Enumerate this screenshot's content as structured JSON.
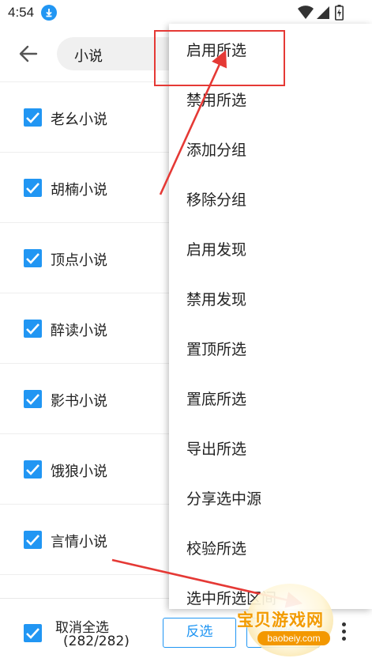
{
  "status_bar": {
    "time": "4:54"
  },
  "toolbar": {
    "search_value": "小说"
  },
  "list": {
    "items": [
      {
        "label": "老幺小说",
        "checked": true
      },
      {
        "label": "胡楠小说",
        "checked": true
      },
      {
        "label": "顶点小说",
        "checked": true
      },
      {
        "label": "醉读小说",
        "checked": true
      },
      {
        "label": "影书小说",
        "checked": true
      },
      {
        "label": "饿狼小说",
        "checked": true
      },
      {
        "label": "言情小说",
        "checked": true
      }
    ]
  },
  "menu": {
    "items": [
      {
        "label": "启用所选"
      },
      {
        "label": "禁用所选"
      },
      {
        "label": "添加分组"
      },
      {
        "label": "移除分组"
      },
      {
        "label": "启用发现"
      },
      {
        "label": "禁用发现"
      },
      {
        "label": "置顶所选"
      },
      {
        "label": "置底所选"
      },
      {
        "label": "导出所选"
      },
      {
        "label": "分享选中源"
      },
      {
        "label": "校验所选"
      },
      {
        "label": "选中所选区间"
      }
    ]
  },
  "bottom_bar": {
    "select_all_label": "取消全选",
    "count": "(282/282)",
    "invert_label": "反选",
    "delete_label": "删除"
  },
  "watermark": {
    "text": "宝贝游戏网",
    "url": "baobeiy.com"
  },
  "colors": {
    "accent": "#2196f3",
    "annotation": "#e53935",
    "watermark": "#f39800"
  }
}
